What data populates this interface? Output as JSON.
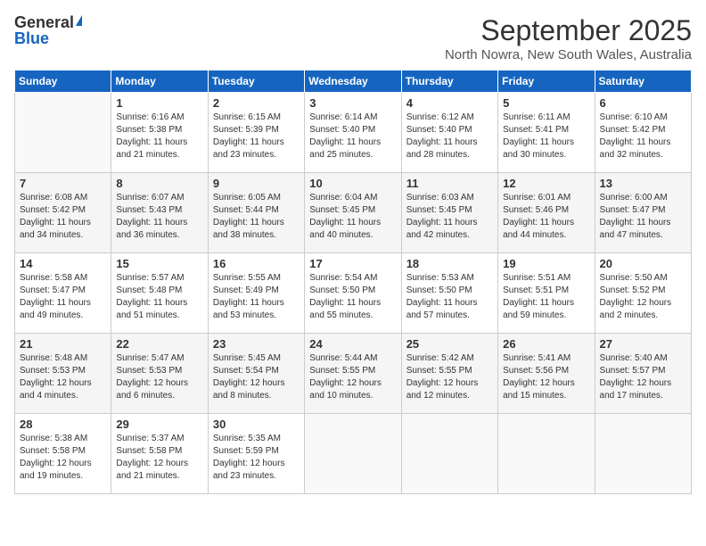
{
  "header": {
    "logo_general": "General",
    "logo_blue": "Blue",
    "month": "September 2025",
    "location": "North Nowra, New South Wales, Australia"
  },
  "weekdays": [
    "Sunday",
    "Monday",
    "Tuesday",
    "Wednesday",
    "Thursday",
    "Friday",
    "Saturday"
  ],
  "weeks": [
    [
      {
        "day": "",
        "empty": true
      },
      {
        "day": "1",
        "sunrise": "6:16 AM",
        "sunset": "5:38 PM",
        "daylight": "11 hours and 21 minutes."
      },
      {
        "day": "2",
        "sunrise": "6:15 AM",
        "sunset": "5:39 PM",
        "daylight": "11 hours and 23 minutes."
      },
      {
        "day": "3",
        "sunrise": "6:14 AM",
        "sunset": "5:40 PM",
        "daylight": "11 hours and 25 minutes."
      },
      {
        "day": "4",
        "sunrise": "6:12 AM",
        "sunset": "5:40 PM",
        "daylight": "11 hours and 28 minutes."
      },
      {
        "day": "5",
        "sunrise": "6:11 AM",
        "sunset": "5:41 PM",
        "daylight": "11 hours and 30 minutes."
      },
      {
        "day": "6",
        "sunrise": "6:10 AM",
        "sunset": "5:42 PM",
        "daylight": "11 hours and 32 minutes."
      }
    ],
    [
      {
        "day": "7",
        "sunrise": "6:08 AM",
        "sunset": "5:42 PM",
        "daylight": "11 hours and 34 minutes."
      },
      {
        "day": "8",
        "sunrise": "6:07 AM",
        "sunset": "5:43 PM",
        "daylight": "11 hours and 36 minutes."
      },
      {
        "day": "9",
        "sunrise": "6:05 AM",
        "sunset": "5:44 PM",
        "daylight": "11 hours and 38 minutes."
      },
      {
        "day": "10",
        "sunrise": "6:04 AM",
        "sunset": "5:45 PM",
        "daylight": "11 hours and 40 minutes."
      },
      {
        "day": "11",
        "sunrise": "6:03 AM",
        "sunset": "5:45 PM",
        "daylight": "11 hours and 42 minutes."
      },
      {
        "day": "12",
        "sunrise": "6:01 AM",
        "sunset": "5:46 PM",
        "daylight": "11 hours and 44 minutes."
      },
      {
        "day": "13",
        "sunrise": "6:00 AM",
        "sunset": "5:47 PM",
        "daylight": "11 hours and 47 minutes."
      }
    ],
    [
      {
        "day": "14",
        "sunrise": "5:58 AM",
        "sunset": "5:47 PM",
        "daylight": "11 hours and 49 minutes."
      },
      {
        "day": "15",
        "sunrise": "5:57 AM",
        "sunset": "5:48 PM",
        "daylight": "11 hours and 51 minutes."
      },
      {
        "day": "16",
        "sunrise": "5:55 AM",
        "sunset": "5:49 PM",
        "daylight": "11 hours and 53 minutes."
      },
      {
        "day": "17",
        "sunrise": "5:54 AM",
        "sunset": "5:50 PM",
        "daylight": "11 hours and 55 minutes."
      },
      {
        "day": "18",
        "sunrise": "5:53 AM",
        "sunset": "5:50 PM",
        "daylight": "11 hours and 57 minutes."
      },
      {
        "day": "19",
        "sunrise": "5:51 AM",
        "sunset": "5:51 PM",
        "daylight": "11 hours and 59 minutes."
      },
      {
        "day": "20",
        "sunrise": "5:50 AM",
        "sunset": "5:52 PM",
        "daylight": "12 hours and 2 minutes."
      }
    ],
    [
      {
        "day": "21",
        "sunrise": "5:48 AM",
        "sunset": "5:53 PM",
        "daylight": "12 hours and 4 minutes."
      },
      {
        "day": "22",
        "sunrise": "5:47 AM",
        "sunset": "5:53 PM",
        "daylight": "12 hours and 6 minutes."
      },
      {
        "day": "23",
        "sunrise": "5:45 AM",
        "sunset": "5:54 PM",
        "daylight": "12 hours and 8 minutes."
      },
      {
        "day": "24",
        "sunrise": "5:44 AM",
        "sunset": "5:55 PM",
        "daylight": "12 hours and 10 minutes."
      },
      {
        "day": "25",
        "sunrise": "5:42 AM",
        "sunset": "5:55 PM",
        "daylight": "12 hours and 12 minutes."
      },
      {
        "day": "26",
        "sunrise": "5:41 AM",
        "sunset": "5:56 PM",
        "daylight": "12 hours and 15 minutes."
      },
      {
        "day": "27",
        "sunrise": "5:40 AM",
        "sunset": "5:57 PM",
        "daylight": "12 hours and 17 minutes."
      }
    ],
    [
      {
        "day": "28",
        "sunrise": "5:38 AM",
        "sunset": "5:58 PM",
        "daylight": "12 hours and 19 minutes."
      },
      {
        "day": "29",
        "sunrise": "5:37 AM",
        "sunset": "5:58 PM",
        "daylight": "12 hours and 21 minutes."
      },
      {
        "day": "30",
        "sunrise": "5:35 AM",
        "sunset": "5:59 PM",
        "daylight": "12 hours and 23 minutes."
      },
      {
        "day": "",
        "empty": true
      },
      {
        "day": "",
        "empty": true
      },
      {
        "day": "",
        "empty": true
      },
      {
        "day": "",
        "empty": true
      }
    ]
  ]
}
